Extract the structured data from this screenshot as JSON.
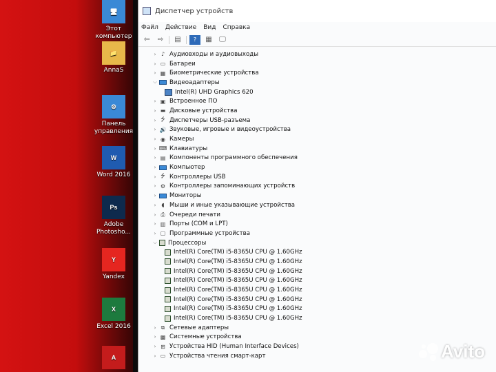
{
  "desktop": {
    "icons": [
      {
        "name": "this-pc-icon",
        "label": "Этот компьютер",
        "glyph": "🖥",
        "color": "#3a89d6"
      },
      {
        "name": "user-folder-icon",
        "label": "AnnaS",
        "glyph": "📁",
        "color": "#e8b84a"
      },
      {
        "name": "control-panel-icon",
        "label": "Панель управления",
        "glyph": "⚙",
        "color": "#3a89d6"
      },
      {
        "name": "word-icon",
        "label": "Word 2016",
        "glyph": "W",
        "color": "#1f5bb0"
      },
      {
        "name": "photoshop-icon",
        "label": "Adobe Photosho...",
        "glyph": "Ps",
        "color": "#0e2a4d"
      },
      {
        "name": "yandex-icon",
        "label": "Yandex",
        "glyph": "Y",
        "color": "#e52620"
      },
      {
        "name": "excel-icon",
        "label": "Excel 2016",
        "glyph": "X",
        "color": "#1d7a3e"
      },
      {
        "name": "acrobat-icon",
        "label": "",
        "glyph": "A",
        "color": "#c41c1c"
      }
    ]
  },
  "window": {
    "title": "Диспетчер устройств",
    "menu": [
      "Файл",
      "Действие",
      "Вид",
      "Справка"
    ]
  },
  "toolbar": {
    "buttons": [
      {
        "name": "back-icon",
        "glyph": "⇦"
      },
      {
        "name": "forward-icon",
        "glyph": "⇨"
      },
      {
        "name": "properties-icon",
        "glyph": "▤"
      },
      {
        "name": "help-icon",
        "glyph": "?"
      },
      {
        "name": "view-icon",
        "glyph": "▦"
      },
      {
        "name": "monitor-scan-icon",
        "glyph": "🖵"
      }
    ]
  },
  "tree": [
    {
      "label": "Аудиовходы и аудиовыходы",
      "expanded": false,
      "icon": "audio"
    },
    {
      "label": "Батареи",
      "expanded": false,
      "icon": "battery"
    },
    {
      "label": "Биометрические устройства",
      "expanded": false,
      "icon": "biometric"
    },
    {
      "label": "Видеоадаптеры",
      "expanded": true,
      "icon": "monitor"
    },
    {
      "label": "Intel(R) UHD Graphics 620",
      "child": true,
      "icon": "gpu"
    },
    {
      "label": "Встроенное ПО",
      "expanded": false,
      "icon": "firmware"
    },
    {
      "label": "Дисковые устройства",
      "expanded": false,
      "icon": "disk"
    },
    {
      "label": "Диспетчеры USB-разъема",
      "expanded": false,
      "icon": "usb"
    },
    {
      "label": "Звуковые, игровые и видеоустройства",
      "expanded": false,
      "icon": "sound"
    },
    {
      "label": "Камеры",
      "expanded": false,
      "icon": "camera"
    },
    {
      "label": "Клавиатуры",
      "expanded": false,
      "icon": "keyboard"
    },
    {
      "label": "Компоненты программного обеспечения",
      "expanded": false,
      "icon": "component"
    },
    {
      "label": "Компьютер",
      "expanded": false,
      "icon": "monitor"
    },
    {
      "label": "Контроллеры USB",
      "expanded": false,
      "icon": "usb"
    },
    {
      "label": "Контроллеры запоминающих устройств",
      "expanded": false,
      "icon": "storage"
    },
    {
      "label": "Мониторы",
      "expanded": false,
      "icon": "monitor"
    },
    {
      "label": "Мыши и иные указывающие устройства",
      "expanded": false,
      "icon": "mouse"
    },
    {
      "label": "Очереди печати",
      "expanded": false,
      "icon": "printer"
    },
    {
      "label": "Порты (COM и LPT)",
      "expanded": false,
      "icon": "port"
    },
    {
      "label": "Программные устройства",
      "expanded": false,
      "icon": "software"
    },
    {
      "label": "Процессоры",
      "expanded": true,
      "icon": "cpu"
    },
    {
      "label": "Intel(R) Core(TM) i5-8365U CPU @ 1.60GHz",
      "child": true,
      "icon": "cpu"
    },
    {
      "label": "Intel(R) Core(TM) i5-8365U CPU @ 1.60GHz",
      "child": true,
      "icon": "cpu"
    },
    {
      "label": "Intel(R) Core(TM) i5-8365U CPU @ 1.60GHz",
      "child": true,
      "icon": "cpu"
    },
    {
      "label": "Intel(R) Core(TM) i5-8365U CPU @ 1.60GHz",
      "child": true,
      "icon": "cpu"
    },
    {
      "label": "Intel(R) Core(TM) i5-8365U CPU @ 1.60GHz",
      "child": true,
      "icon": "cpu"
    },
    {
      "label": "Intel(R) Core(TM) i5-8365U CPU @ 1.60GHz",
      "child": true,
      "icon": "cpu"
    },
    {
      "label": "Intel(R) Core(TM) i5-8365U CPU @ 1.60GHz",
      "child": true,
      "icon": "cpu"
    },
    {
      "label": "Intel(R) Core(TM) i5-8365U CPU @ 1.60GHz",
      "child": true,
      "icon": "cpu"
    },
    {
      "label": "Сетевые адаптеры",
      "expanded": false,
      "icon": "network"
    },
    {
      "label": "Системные устройства",
      "expanded": false,
      "icon": "system"
    },
    {
      "label": "Устройства HID (Human Interface Devices)",
      "expanded": false,
      "icon": "hid"
    },
    {
      "label": "Устройства чтения смарт-карт",
      "expanded": false,
      "icon": "smartcard"
    }
  ],
  "watermark": {
    "text": "Avito"
  }
}
